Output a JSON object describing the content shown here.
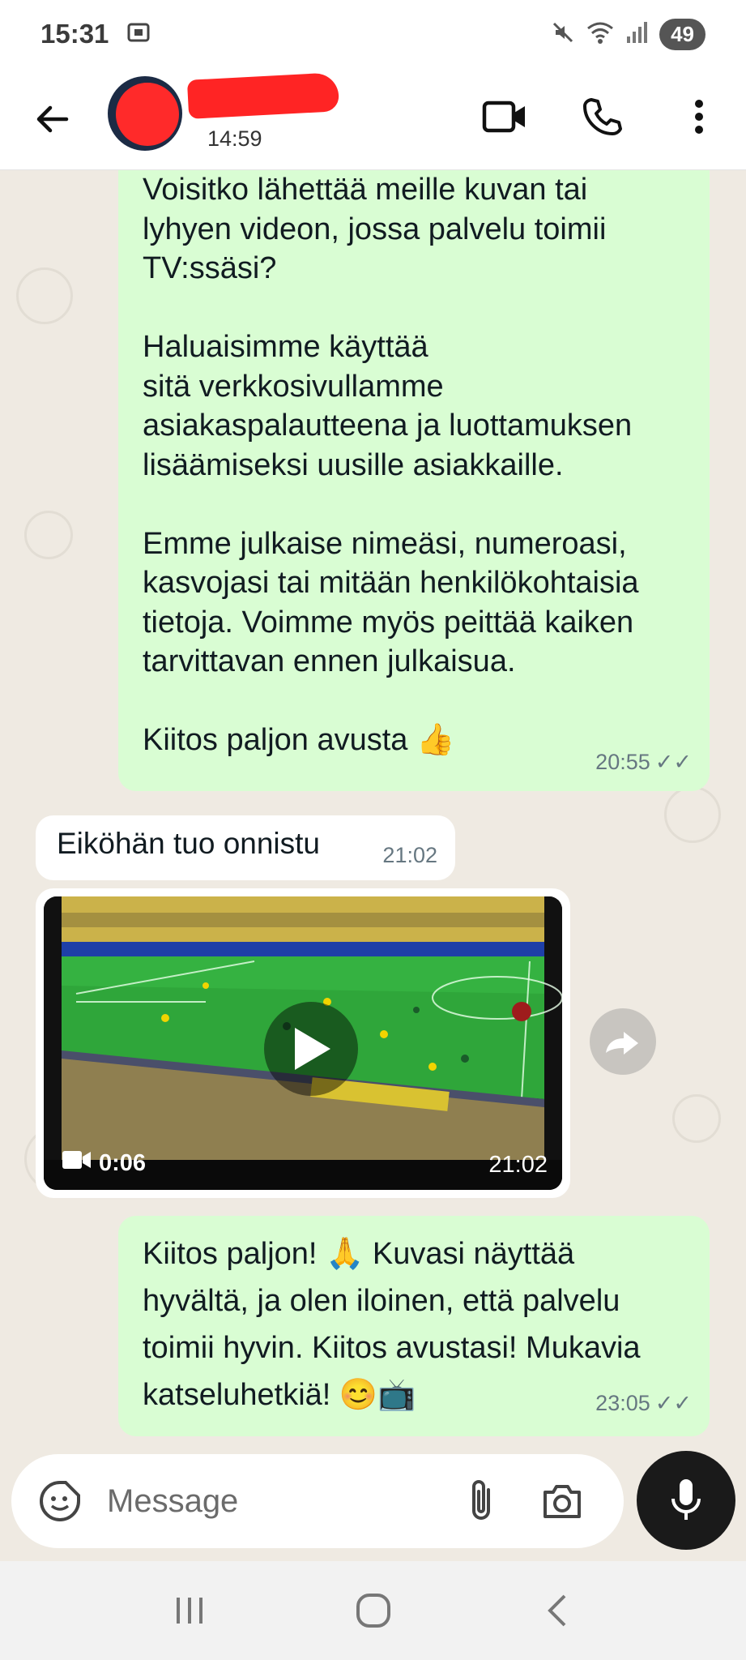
{
  "status_bar": {
    "time": "15:31",
    "battery": "49",
    "icons": [
      "screenshot-icon",
      "mute-icon",
      "wifi-icon",
      "signal-icon"
    ]
  },
  "header": {
    "last_seen": "14:59",
    "icons": [
      "back-arrow-icon",
      "video-call-icon",
      "voice-call-icon",
      "more-options-icon"
    ]
  },
  "messages": [
    {
      "direction": "outgoing",
      "text": "Voisitko lähettää meille kuvan tai\nlyhyen videon, jossa palvelu toimii\nTV:ssäsi?\n\nHaluaisimme käyttää\nsitä verkkosivullamme\nasiakaspalautteena ja luottamuksen\nlisäämiseksi uusille asiakkaille.\n\nEmme julkaise nimeäsi, numeroasi,\nkasvojasi tai mitään henkilökohtaisia\ntietoja. Voimme myös peittää kaiken\ntarvittavan ennen julkaisua.\n\nKiitos paljon avusta 👍",
      "time": "20:55",
      "ticks": "✓✓"
    },
    {
      "direction": "incoming",
      "text": "Eiköhän tuo onnistu",
      "time": "21:02"
    },
    {
      "direction": "incoming",
      "type": "video",
      "duration": "0:06",
      "time": "21:02"
    },
    {
      "direction": "outgoing",
      "text": "Kiitos paljon! 🙏 Kuvasi näyttää\nhyvältä, ja olen iloinen, että palvelu\ntoimii hyvin. Kiitos avustasi! Mukavia\nkatseluhetkiä! 😊📺",
      "time": "23:05",
      "ticks": "✓✓"
    }
  ],
  "input": {
    "placeholder": "Message"
  },
  "colors": {
    "outgoing_bubble": "#d9fdd3",
    "incoming_bubble": "#ffffff",
    "chat_background": "#efeae2",
    "mic_button": "#1a1a1a"
  },
  "nav": {
    "icons": [
      "recent-apps-icon",
      "home-icon",
      "back-nav-icon"
    ]
  }
}
